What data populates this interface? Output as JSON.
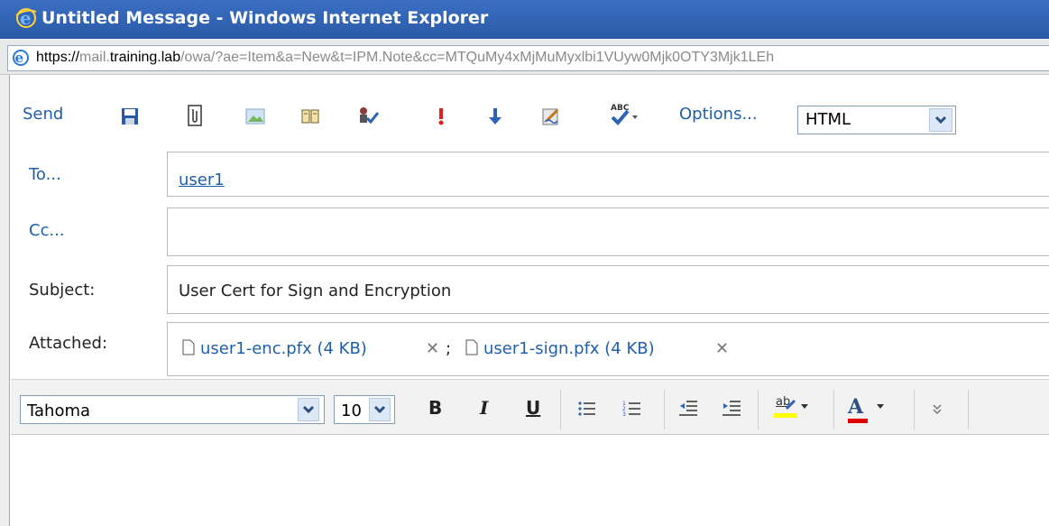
{
  "window": {
    "title": "Untitled Message - Windows Internet Explorer",
    "address_prefix": "https://",
    "address_host_pre": "mail.",
    "address_host": "training.lab",
    "address_path": "/owa/?ae=Item&a=New&t=IPM.Note&cc=MTQuMy4xMjMuMyxlbi1VUyw0Mjk0OTY3Mjk1LEh"
  },
  "toolbar": {
    "send_label": "Send",
    "options_label": "Options...",
    "format_value": "HTML",
    "icons": [
      "save-icon",
      "attach-icon",
      "insert-image-icon",
      "address-book-icon",
      "check-names-icon",
      "high-importance-icon",
      "low-importance-icon",
      "signature-icon",
      "spelling-icon"
    ]
  },
  "form": {
    "to_label": "To...",
    "to_value": "user1",
    "cc_label": "Cc...",
    "cc_value": "",
    "subject_label": "Subject:",
    "subject_value": "User Cert for Sign and Encryption",
    "attached_label": "Attached:",
    "attachments": [
      {
        "name": "user1-enc.pfx (4 KB)",
        "sep": ";"
      },
      {
        "name": "user1-sign.pfx (4 KB)",
        "sep": ""
      }
    ]
  },
  "format_toolbar": {
    "font_value": "Tahoma",
    "size_value": "10",
    "bold": "B",
    "italic": "I",
    "underline": "U",
    "font_color_letter": "A",
    "highlight_letters": "ab",
    "highlight_color": "#ffff00",
    "font_color": "#e00000"
  },
  "colors": {
    "title_bar": "#2f5ea8",
    "link": "#1f5fa8"
  }
}
